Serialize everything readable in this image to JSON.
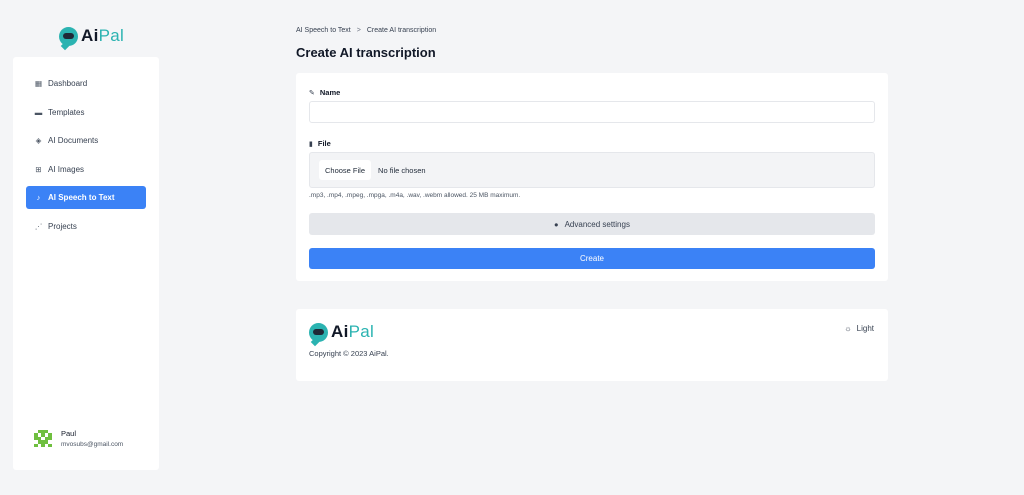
{
  "brand": {
    "name_part1": "Ai",
    "name_part2": "Pal"
  },
  "colors": {
    "accent": "#3b82f6",
    "brand": "#2bb3b1",
    "background": "#f4f5f7"
  },
  "sidebar": {
    "items": [
      {
        "label": "Dashboard",
        "icon": "grid-icon"
      },
      {
        "label": "Templates",
        "icon": "scroll-icon"
      },
      {
        "label": "AI Documents",
        "icon": "layers-icon"
      },
      {
        "label": "AI Images",
        "icon": "images-icon"
      },
      {
        "label": "AI Speech to Text",
        "icon": "microphone-icon",
        "active": true
      },
      {
        "label": "Projects",
        "icon": "network-icon"
      }
    ],
    "user": {
      "name": "Paul",
      "email": "mvosubs@gmail.com"
    }
  },
  "breadcrumb": {
    "parent": "AI Speech to Text",
    "separator": ">",
    "current": "Create AI transcription"
  },
  "page": {
    "title": "Create AI transcription"
  },
  "form": {
    "name_label": "Name",
    "name_value": "",
    "file_label": "File",
    "choose_file": "Choose File",
    "no_file": "No file chosen",
    "hint": ".mp3, .mp4, .mpeg, .mpga, .m4a, .wav, .webm allowed. 25 MB maximum.",
    "advanced_label": "Advanced settings",
    "create_label": "Create"
  },
  "footer": {
    "theme_label": "Light",
    "copyright": "Copyright © 2023 AiPal."
  }
}
